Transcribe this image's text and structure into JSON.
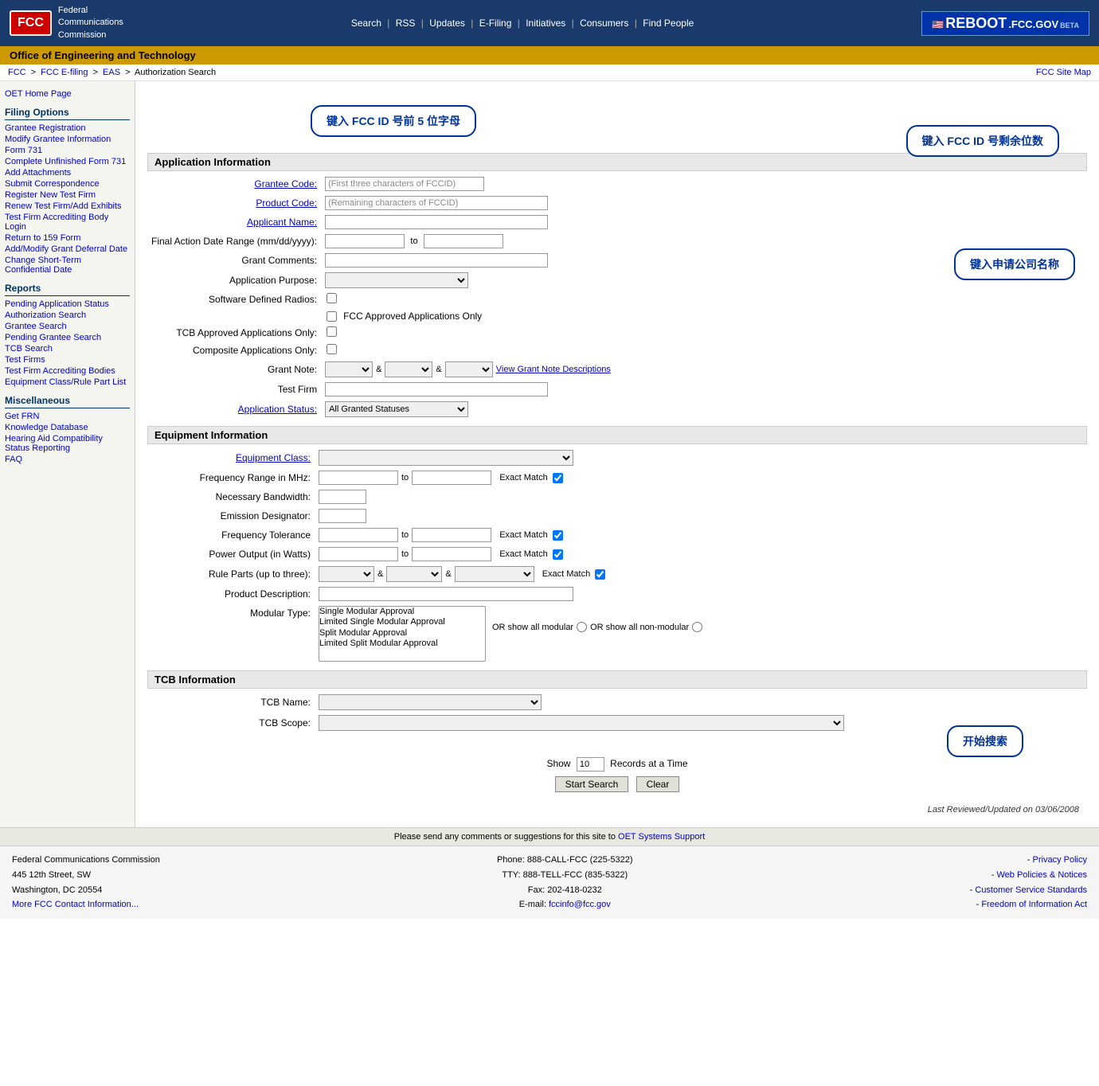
{
  "header": {
    "logo_text": "FCC",
    "org_line1": "Federal",
    "org_line2": "Communications",
    "org_line3": "Commission",
    "nav_items": [
      "Search",
      "RSS",
      "Updates",
      "E-Filing",
      "Initiatives",
      "Consumers",
      "Find People"
    ],
    "nav_separators": [
      "|",
      "|",
      "|",
      "|",
      "|",
      "|"
    ],
    "reboot_text": "REBOOT",
    "reboot_domain": ".FCC.GOV",
    "reboot_beta": "BETA"
  },
  "oet_banner": {
    "title": "Office of Engineering and Technology"
  },
  "breadcrumb": {
    "items": [
      "FCC",
      "FCC E-filing",
      "EAS",
      "Authorization Search"
    ],
    "separators": [
      ">",
      ">",
      ">"
    ],
    "site_map": "FCC Site Map"
  },
  "sidebar": {
    "sections": [
      {
        "title": "Filing Options",
        "links": [
          "Grantee Registration",
          "Modify Grantee Information",
          "Form 731",
          "Complete Unfinished Form 731",
          "Add Attachments",
          "Submit Correspondence",
          "Register New Test Firm",
          "Renew Test Firm/Add Exhibits",
          "Test Firm Accrediting Body Login",
          "Return to 159 Form",
          "Add/Modify Grant Deferral Date",
          "Change Short-Term Confidential Date"
        ]
      },
      {
        "title": "Reports",
        "links": [
          "Pending Application Status",
          "Authorization Search",
          "Grantee Search",
          "Pending Grantee Search",
          "TCB Search",
          "Test Firms",
          "Test Firm Accrediting Bodies",
          "Equipment Class/Rule Part List"
        ]
      },
      {
        "title": "Miscellaneous",
        "links": [
          "Get FRN",
          "Knowledge Database",
          "Hearing Aid Compatibility Status Reporting",
          "FAQ"
        ]
      }
    ]
  },
  "app_info": {
    "section_title": "Application Information",
    "grantee_code_label": "Grantee Code:",
    "grantee_code_placeholder": "(First three characters of FCCID)",
    "product_code_label": "Product Code:",
    "product_code_placeholder": "(Remaining characters of FCCID)",
    "applicant_name_label": "Applicant Name:",
    "final_action_label": "Final Action Date Range (mm/dd/yyyy):",
    "final_action_to": "to",
    "grant_comments_label": "Grant Comments:",
    "app_purpose_label": "Application Purpose:",
    "sdr_label": "Software Defined Radios:",
    "fcc_approved_label": "FCC Approved Applications Only",
    "tcb_approved_label": "TCB Approved Applications Only:",
    "composite_label": "Composite Applications Only:",
    "grant_note_label": "Grant Note:",
    "grant_note_and1": "&",
    "grant_note_and2": "&",
    "view_grant_note": "View Grant Note Descriptions",
    "test_firm_label": "Test Firm",
    "app_status_label": "Application Status:",
    "app_status_value": "All Granted Statuses"
  },
  "equipment_info": {
    "section_title": "Equipment Information",
    "equipment_class_label": "Equipment Class:",
    "frequency_range_label": "Frequency Range in MHz:",
    "frequency_to": "to",
    "frequency_exact": "Exact Match",
    "necessary_bw_label": "Necessary Bandwidth:",
    "emission_designator_label": "Emission Designator:",
    "freq_tolerance_label": "Frequency Tolerance",
    "freq_tolerance_to": "to",
    "freq_tolerance_exact": "Exact Match",
    "power_output_label": "Power Output (in Watts)",
    "power_output_to": "to",
    "power_output_exact": "Exact Match",
    "rule_parts_label": "Rule Parts (up to three):",
    "rule_parts_and1": "&",
    "rule_parts_and2": "&",
    "rule_parts_exact": "Exact Match",
    "product_desc_label": "Product Description:",
    "modular_type_label": "Modular Type:",
    "modular_options": [
      "Single Modular Approval",
      "Limited Single Modular Approval",
      "Split Modular Approval",
      "Limited Split Modular Approval"
    ],
    "or_show_modular": "OR show all modular",
    "or_show_non_modular": "OR show all non-modular"
  },
  "tcb_info": {
    "section_title": "TCB Information",
    "tcb_name_label": "TCB Name:",
    "tcb_scope_label": "TCB Scope:"
  },
  "show_row": {
    "show_label": "Show",
    "show_value": "10",
    "records_label": "Records at a Time"
  },
  "buttons": {
    "start_search": "Start Search",
    "clear": "Clear"
  },
  "tooltips": {
    "tooltip1": "键入 FCC ID 号前 5 位字母",
    "tooltip2": "键入 FCC ID 号剩余位数",
    "tooltip3": "键入申请公司名称",
    "tooltip4": "开始搜索"
  },
  "footer": {
    "last_updated": "Last Reviewed/Updated on 03/06/2008",
    "comments_text": "Please send any comments or suggestions for this site to",
    "comments_link": "OET Systems Support",
    "address_line1": "Federal Communications Commission",
    "address_line2": "445 12th Street, SW",
    "address_line3": "Washington, DC 20554",
    "address_link": "More FCC Contact Information...",
    "phone_label": "Phone:",
    "phone_value": "888-CALL-FCC (225-5322)",
    "tty_label": "TTY:",
    "tty_value": "888-TELL-FCC (835-5322)",
    "fax_label": "Fax:",
    "fax_value": "202-418-0232",
    "email_label": "E-mail:",
    "email_value": "fccinfo@fcc.gov",
    "privacy_link": "Privacy Policy",
    "web_policies_link": "Web Policies & Notices",
    "customer_service_link": "Customer Service Standards",
    "freedom_link": "Freedom of Information Act"
  }
}
